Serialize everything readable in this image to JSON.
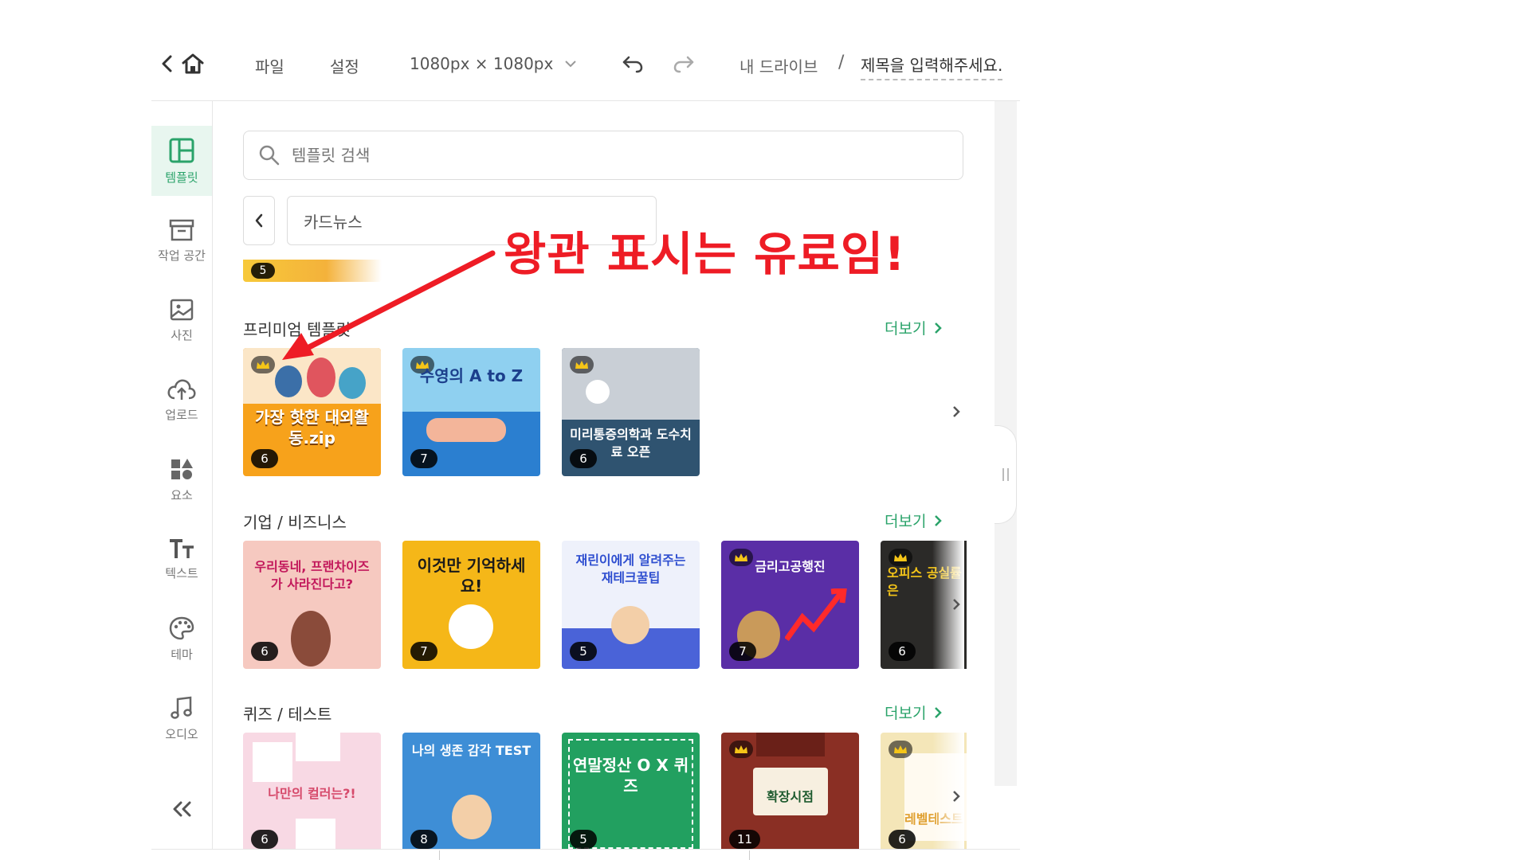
{
  "topbar": {
    "file": "파일",
    "settings": "설정",
    "size": "1080px × 1080px",
    "drive": "내 드라이브",
    "separator": "/",
    "doc_title": "제목을 입력해주세요."
  },
  "sidebar": {
    "items": [
      {
        "label": "템플릿",
        "icon": "layout-icon"
      },
      {
        "label": "작업 공간",
        "icon": "archive-icon"
      },
      {
        "label": "사진",
        "icon": "image-icon"
      },
      {
        "label": "업로드",
        "icon": "cloud-upload-icon"
      },
      {
        "label": "요소",
        "icon": "shapes-icon"
      },
      {
        "label": "텍스트",
        "icon": "text-icon"
      },
      {
        "label": "테마",
        "icon": "palette-icon"
      },
      {
        "label": "오디오",
        "icon": "music-note-icon"
      }
    ]
  },
  "panel": {
    "search_placeholder": "템플릿 검색",
    "category": "카드뉴스",
    "peek_count": "5",
    "sections": [
      {
        "title": "프리미엄 템플릿",
        "more": "더보기",
        "cards": [
          {
            "count": "6",
            "premium": true,
            "title": "가장 핫한 대외활동.zip",
            "bg": "#f7a21b"
          },
          {
            "count": "7",
            "premium": true,
            "title": "수영의 A to Z",
            "bg": "#8fd0f0"
          },
          {
            "count": "6",
            "premium": true,
            "title": "미리통증의학과 도수치료 오픈",
            "bg": "#2f5370"
          }
        ]
      },
      {
        "title": "기업 / 비즈니스",
        "more": "더보기",
        "cards": [
          {
            "count": "6",
            "premium": false,
            "title": "우리동네, 프랜차이즈가 사라진다고?",
            "bg": "#f6c9c0"
          },
          {
            "count": "7",
            "premium": false,
            "title": "이것만 기억하세요!",
            "bg": "#f5b718"
          },
          {
            "count": "5",
            "premium": false,
            "title": "재린이에게 알려주는 재테크꿀팁",
            "bg": "#eef1fb"
          },
          {
            "count": "7",
            "premium": true,
            "title": "금리고공행진",
            "bg": "#5a2ea6"
          },
          {
            "count": "6",
            "premium": true,
            "title": "오피스 공실률 내 공간은",
            "bg": "#2b2a28"
          }
        ]
      },
      {
        "title": "퀴즈 / 테스트",
        "more": "더보기",
        "cards": [
          {
            "count": "6",
            "premium": false,
            "title": "나만의 컬러는?!",
            "bg": "#f8d9e4"
          },
          {
            "count": "8",
            "premium": false,
            "title": "나의 생존 감각 TEST",
            "bg": "#3e8ed6"
          },
          {
            "count": "5",
            "premium": false,
            "title": "연말정산 O X 퀴즈",
            "bg": "#22a060"
          },
          {
            "count": "11",
            "premium": true,
            "title": "확장시점",
            "bg": "#8a2f24"
          },
          {
            "count": "6",
            "premium": true,
            "title": "레벨테스트",
            "bg": "#f4e6b8"
          }
        ]
      }
    ]
  },
  "annotation": {
    "text": "왕관 표시는 유료임!",
    "color": "#ee1c25"
  },
  "colors": {
    "accent": "#2aa36a",
    "accent_bg": "#e8f6ef"
  }
}
